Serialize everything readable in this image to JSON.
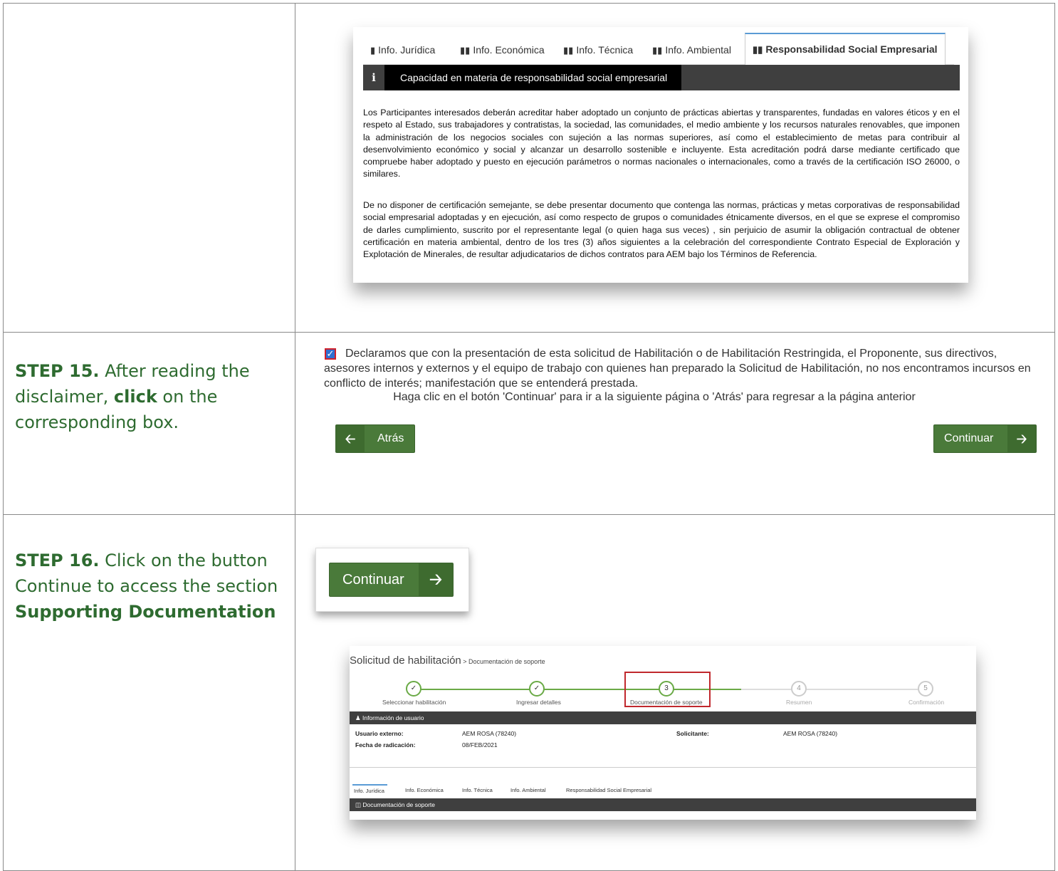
{
  "row1": {
    "tabs": [
      {
        "label": "Info. Jurídica"
      },
      {
        "label": "Info. Económica"
      },
      {
        "label": "Info. Técnica"
      },
      {
        "label": "Info. Ambiental"
      },
      {
        "label": "Responsabilidad Social Empresarial"
      }
    ],
    "info_title": "Capacidad en materia de responsabilidad social empresarial",
    "paragraph1": "Los Participantes interesados deberán acreditar haber adoptado un conjunto de prácticas abiertas y transparentes, fundadas en valores éticos y en el respeto al Estado, sus trabajadores y contratistas, la sociedad, las comunidades, el medio ambiente y los recursos naturales renovables, que imponen la administración de los negocios sociales con sujeción a las normas superiores, así como el establecimiento de metas para contribuir al desenvolvimiento económico y social y alcanzar un desarrollo sostenible e incluyente. Esta acreditación podrá darse mediante certificado que compruebe haber adoptado y puesto en ejecución parámetros o normas nacionales o internacionales, como a través de la certificación ISO 26000, o similares.",
    "paragraph2": "De no disponer de certificación semejante, se debe presentar documento que contenga las normas, prácticas y metas corporativas de responsabilidad social empresarial adoptadas y en ejecución, así como respecto de grupos o comunidades étnicamente diversos, en el que se exprese el compromiso de darles cumplimiento, suscrito por el representante legal (o quien haga sus veces) , sin perjuicio de asumir la obligación contractual de obtener certificación en materia ambiental, dentro de los tres (3) años siguientes a la celebración del correspondiente Contrato Especial de Exploración y Explotación de Minerales, de resultar adjudicatarios de dichos contratos para AEM bajo los Términos de Referencia."
  },
  "row2": {
    "step_label": "STEP 15.",
    "step_text_a": " After reading the disclaimer, ",
    "step_bold": "click",
    "step_text_b": " on the corresponding box.",
    "disclaimer": "Declaramos que con la presentación de esta solicitud de Habilitación o de Habilitación Restringida, el Proponente, sus directivos, asesores internos y externos y el equipo de trabajo con quienes han preparado la Solicitud de Habilitación, no nos encontramos incursos en conflicto de interés; manifestación que se entenderá prestada.",
    "hint": "Haga clic en el botón 'Continuar' para ir a la siguiente página o 'Atrás' para regresar a la página anterior",
    "back_label": "Atrás",
    "continue_label": "Continuar"
  },
  "row3": {
    "step_label": "STEP 16.",
    "step_text": " Click on the button Continue to access the section ",
    "step_bold": "Supporting Documentation",
    "continue_label": "Continuar",
    "screen": {
      "title": "Solicitud de habilitación",
      "breadcrumb": " > Documentación de soporte",
      "steps": [
        {
          "num": "✓",
          "label": "Seleccionar habilitación"
        },
        {
          "num": "✓",
          "label": "Ingresar detalles"
        },
        {
          "num": "3",
          "label": "Documentación de soporte"
        },
        {
          "num": "4",
          "label": "Resumen"
        },
        {
          "num": "5",
          "label": "Confirmación"
        }
      ],
      "user_bar": "Información de usuario",
      "external_user_label": "Usuario externo:",
      "external_user_value": "AEM ROSA (78240)",
      "date_label": "Fecha de radicación:",
      "date_value": "08/FEB/2021",
      "applicant_label": "Solicitante:",
      "applicant_value": "AEM ROSA (78240)",
      "tabs": [
        "Info. Jurídica",
        "Info. Económica",
        "Info. Técnica",
        "Info. Ambiental",
        "Responsabilidad Social Empresarial"
      ],
      "doc_bar": "Documentación de soporte"
    }
  },
  "colors": {
    "step_green": "#2e6b30",
    "button_green": "#4a7a3a",
    "highlight_red": "#c0282d"
  }
}
